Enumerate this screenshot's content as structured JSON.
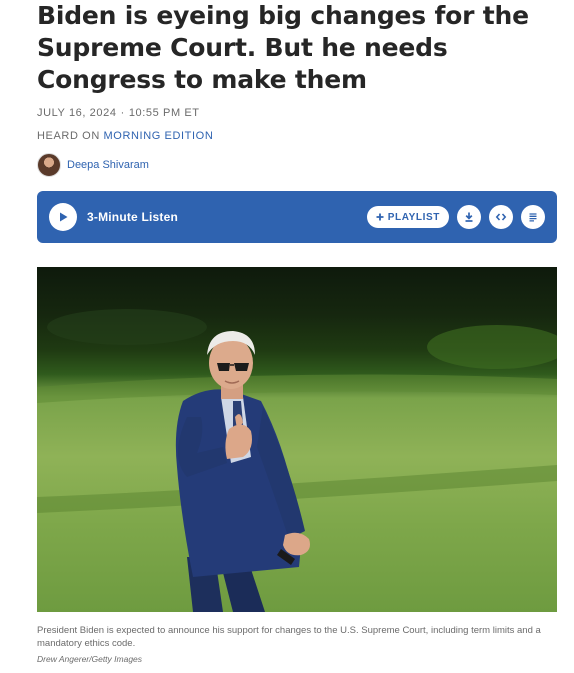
{
  "article": {
    "headline": "Biden is eyeing big changes for the Supreme Court. But he needs Congress to make them",
    "date": "JULY 16, 2024",
    "time": "10:55 PM ET",
    "heard_on_prefix": "HEARD ON",
    "heard_on_program": "MORNING EDITION",
    "author": "Deepa Shivaram"
  },
  "player": {
    "listen_label": "3-Minute Listen",
    "playlist_label": "PLAYLIST",
    "accent_color": "#2f63b0",
    "icons": [
      "play-icon",
      "plus-icon",
      "download-icon",
      "embed-icon",
      "transcript-icon"
    ]
  },
  "media": {
    "caption": "President Biden is expected to announce his support for changes to the U.S. Supreme Court, including term limits and a mandatory ethics code.",
    "credit": "Drew Angerer/Getty Images"
  }
}
